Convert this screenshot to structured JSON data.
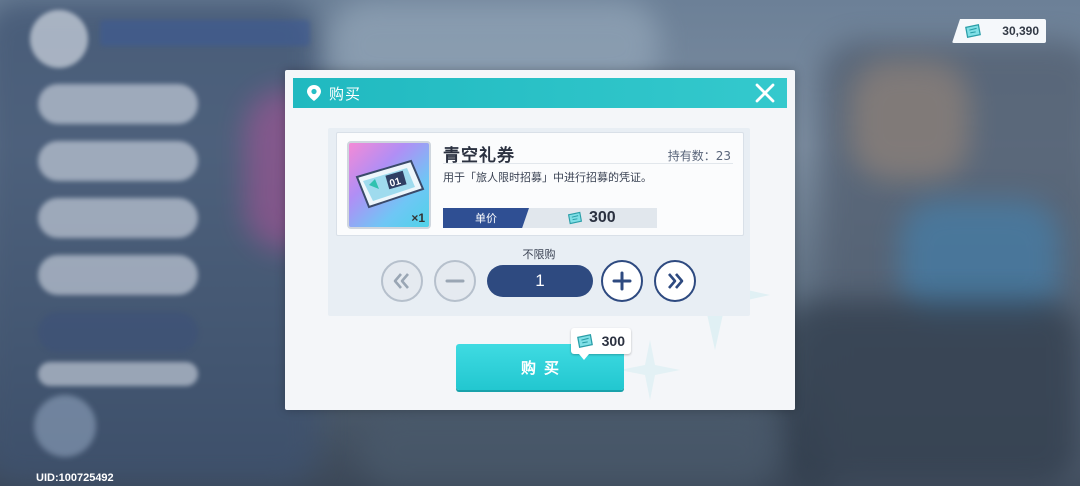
{
  "top": {
    "currency_value": "30,390",
    "uid": "UID:100725492"
  },
  "dialog": {
    "title": "购买",
    "item": {
      "name": "青空礼券",
      "owned_label": "持有数：23",
      "description": "用于「旅人限时招募」中进行招募的凭证。",
      "thumb_count": "×1",
      "thumb_code": "01",
      "unit_price_label": "单价",
      "unit_price": "300"
    },
    "limit_text": "不限购",
    "quantity": "1",
    "buy_label": "购买",
    "total_cost": "300"
  },
  "colors": {
    "accent_teal": "#20b9c0",
    "navy": "#2e4a80",
    "price_label_bg": "#2f4f93"
  },
  "icons": [
    "ticket-icon",
    "location-pin-icon",
    "close-icon",
    "double-left-icon",
    "minus-icon",
    "plus-icon",
    "double-right-icon"
  ]
}
